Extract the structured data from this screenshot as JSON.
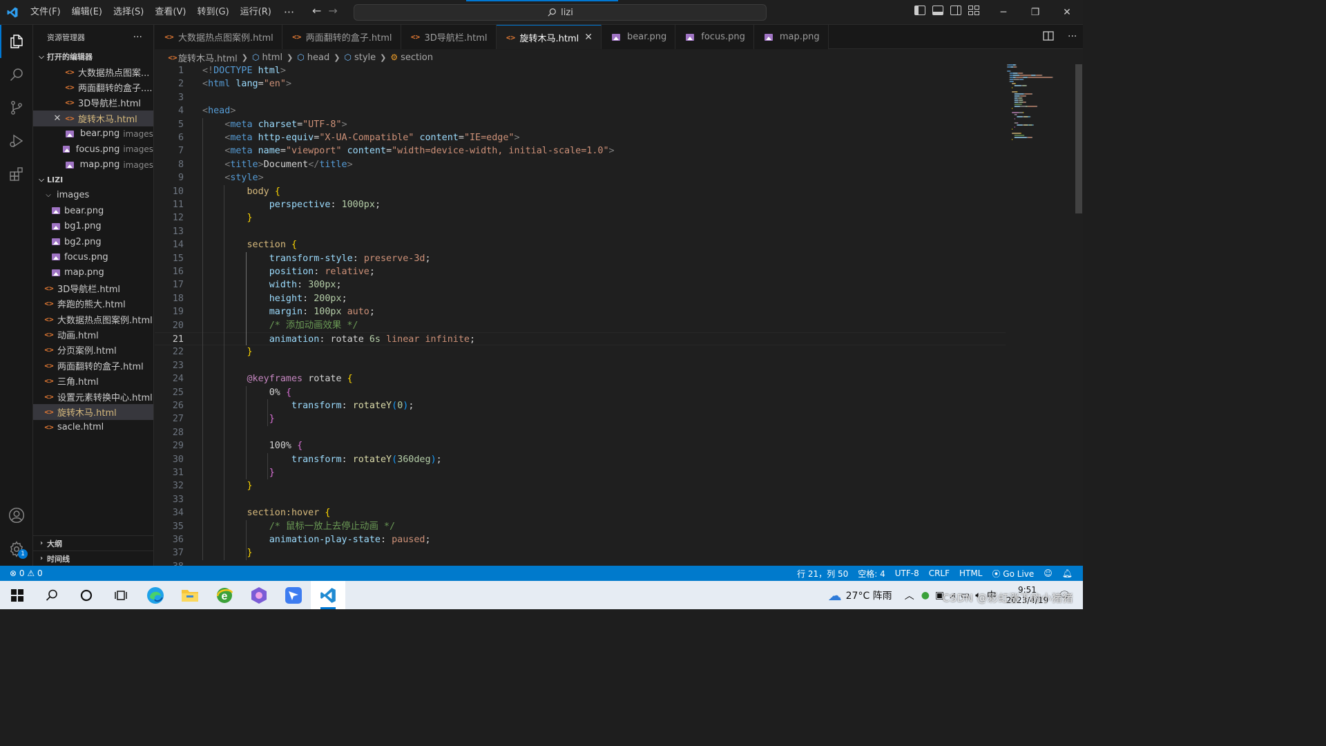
{
  "titlebar": {
    "menus": [
      "文件(F)",
      "编辑(E)",
      "选择(S)",
      "查看(V)",
      "转到(G)",
      "运行(R)"
    ],
    "more": "···",
    "search": "lizi"
  },
  "explorer": {
    "title": "资源管理器",
    "more": "···",
    "open_editors_label": "打开的编辑器",
    "open_editors": [
      {
        "name": "大数据热点图案...",
        "type": "html",
        "hint": ""
      },
      {
        "name": "两面翻转的盒子....",
        "type": "html",
        "hint": ""
      },
      {
        "name": "3D导航栏.html",
        "type": "html",
        "hint": ""
      },
      {
        "name": "旋转木马.html",
        "type": "html",
        "hint": "",
        "active": true
      },
      {
        "name": "bear.png",
        "type": "png",
        "hint": "images"
      },
      {
        "name": "focus.png",
        "type": "png",
        "hint": "images"
      },
      {
        "name": "map.png",
        "type": "png",
        "hint": "images"
      }
    ],
    "folder_label": "LIZI",
    "images_folder": "images",
    "images": [
      "bear.png",
      "bg1.png",
      "bg2.png",
      "focus.png",
      "map.png"
    ],
    "files": [
      "3D导航栏.html",
      "奔跑的熊大.html",
      "大数据热点图案例.html",
      "动画.html",
      "分页案例.html",
      "两面翻转的盒子.html",
      "三角.html",
      "设置元素转换中心.html",
      "旋转木马.html",
      "sacle.html"
    ],
    "selected_file": "旋转木马.html",
    "outline_label": "大纲",
    "timeline_label": "时间线"
  },
  "tabs": [
    {
      "label": "大数据热点图案例.html",
      "type": "html"
    },
    {
      "label": "两面翻转的盒子.html",
      "type": "html"
    },
    {
      "label": "3D导航栏.html",
      "type": "html"
    },
    {
      "label": "旋转木马.html",
      "type": "html",
      "active": true
    },
    {
      "label": "bear.png",
      "type": "png"
    },
    {
      "label": "focus.png",
      "type": "png"
    },
    {
      "label": "map.png",
      "type": "png"
    }
  ],
  "breadcrumb": [
    "旋转木马.html",
    "html",
    "head",
    "style",
    "section"
  ],
  "editor": {
    "current_line": 21,
    "lines": [
      [
        [
          "tg",
          "<!"
        ],
        [
          "tn",
          "DOCTYPE "
        ],
        [
          "at",
          "html"
        ],
        [
          "tg",
          ">"
        ]
      ],
      [
        [
          "tg",
          "<"
        ],
        [
          "tn",
          "html "
        ],
        [
          "at",
          "lang"
        ],
        [
          "tx",
          "="
        ],
        [
          "st",
          "\"en\""
        ],
        [
          "tg",
          ">"
        ]
      ],
      [],
      [
        [
          "tg",
          "<"
        ],
        [
          "tn",
          "head"
        ],
        [
          "tg",
          ">"
        ]
      ],
      [
        [
          "tx",
          "    "
        ],
        [
          "tg",
          "<"
        ],
        [
          "tn",
          "meta "
        ],
        [
          "at",
          "charset"
        ],
        [
          "tx",
          "="
        ],
        [
          "st",
          "\"UTF-8\""
        ],
        [
          "tg",
          ">"
        ]
      ],
      [
        [
          "tx",
          "    "
        ],
        [
          "tg",
          "<"
        ],
        [
          "tn",
          "meta "
        ],
        [
          "at",
          "http-equiv"
        ],
        [
          "tx",
          "="
        ],
        [
          "st",
          "\"X-UA-Compatible\" "
        ],
        [
          "at",
          "content"
        ],
        [
          "tx",
          "="
        ],
        [
          "st",
          "\"IE=edge\""
        ],
        [
          "tg",
          ">"
        ]
      ],
      [
        [
          "tx",
          "    "
        ],
        [
          "tg",
          "<"
        ],
        [
          "tn",
          "meta "
        ],
        [
          "at",
          "name"
        ],
        [
          "tx",
          "="
        ],
        [
          "st",
          "\"viewport\" "
        ],
        [
          "at",
          "content"
        ],
        [
          "tx",
          "="
        ],
        [
          "st",
          "\"width=device-width, initial-scale=1.0\""
        ],
        [
          "tg",
          ">"
        ]
      ],
      [
        [
          "tx",
          "    "
        ],
        [
          "tg",
          "<"
        ],
        [
          "tn",
          "title"
        ],
        [
          "tg",
          ">"
        ],
        [
          "tx",
          "Document"
        ],
        [
          "tg",
          "</"
        ],
        [
          "tn",
          "title"
        ],
        [
          "tg",
          ">"
        ]
      ],
      [
        [
          "tx",
          "    "
        ],
        [
          "tg",
          "<"
        ],
        [
          "tn",
          "style"
        ],
        [
          "tg",
          ">"
        ]
      ],
      [
        [
          "tx",
          "        "
        ],
        [
          "sel",
          "body "
        ],
        [
          "b1",
          "{"
        ]
      ],
      [
        [
          "tx",
          "            "
        ],
        [
          "pr",
          "perspective"
        ],
        [
          "pc",
          ": "
        ],
        [
          "nm",
          "1000px"
        ],
        [
          "pc",
          ";"
        ]
      ],
      [
        [
          "tx",
          "        "
        ],
        [
          "b1",
          "}"
        ]
      ],
      [],
      [
        [
          "tx",
          "        "
        ],
        [
          "sel",
          "section "
        ],
        [
          "b1",
          "{"
        ]
      ],
      [
        [
          "tx",
          "            "
        ],
        [
          "pr",
          "transform-style"
        ],
        [
          "pc",
          ": "
        ],
        [
          "vk",
          "preserve-3d"
        ],
        [
          "pc",
          ";"
        ]
      ],
      [
        [
          "tx",
          "            "
        ],
        [
          "pr",
          "position"
        ],
        [
          "pc",
          ": "
        ],
        [
          "vk",
          "relative"
        ],
        [
          "pc",
          ";"
        ]
      ],
      [
        [
          "tx",
          "            "
        ],
        [
          "pr",
          "width"
        ],
        [
          "pc",
          ": "
        ],
        [
          "nm",
          "300px"
        ],
        [
          "pc",
          ";"
        ]
      ],
      [
        [
          "tx",
          "            "
        ],
        [
          "pr",
          "height"
        ],
        [
          "pc",
          ": "
        ],
        [
          "nm",
          "200px"
        ],
        [
          "pc",
          ";"
        ]
      ],
      [
        [
          "tx",
          "            "
        ],
        [
          "pr",
          "margin"
        ],
        [
          "pc",
          ": "
        ],
        [
          "nm",
          "100px "
        ],
        [
          "vk",
          "auto"
        ],
        [
          "pc",
          ";"
        ]
      ],
      [
        [
          "tx",
          "            "
        ],
        [
          "cm",
          "/* 添加动画效果 */"
        ]
      ],
      [
        [
          "tx",
          "            "
        ],
        [
          "pr",
          "animation"
        ],
        [
          "pc",
          ": "
        ],
        [
          "tx",
          "rotate "
        ],
        [
          "nm",
          "6s "
        ],
        [
          "vk",
          "linear infinite"
        ],
        [
          "pc",
          ";"
        ]
      ],
      [
        [
          "tx",
          "        "
        ],
        [
          "b1",
          "}"
        ]
      ],
      [],
      [
        [
          "tx",
          "        "
        ],
        [
          "kw",
          "@keyframes "
        ],
        [
          "tx",
          "rotate "
        ],
        [
          "b1",
          "{"
        ]
      ],
      [
        [
          "tx",
          "            "
        ],
        [
          "tx",
          "0% "
        ],
        [
          "b2",
          "{"
        ]
      ],
      [
        [
          "tx",
          "                "
        ],
        [
          "pr",
          "transform"
        ],
        [
          "pc",
          ": "
        ],
        [
          "fn",
          "rotateY"
        ],
        [
          "b3",
          "("
        ],
        [
          "nm",
          "0"
        ],
        [
          "b3",
          ")"
        ],
        [
          "pc",
          ";"
        ]
      ],
      [
        [
          "tx",
          "            "
        ],
        [
          "b2",
          "}"
        ]
      ],
      [],
      [
        [
          "tx",
          "            "
        ],
        [
          "tx",
          "100% "
        ],
        [
          "b2",
          "{"
        ]
      ],
      [
        [
          "tx",
          "                "
        ],
        [
          "pr",
          "transform"
        ],
        [
          "pc",
          ": "
        ],
        [
          "fn",
          "rotateY"
        ],
        [
          "b3",
          "("
        ],
        [
          "nm",
          "360deg"
        ],
        [
          "b3",
          ")"
        ],
        [
          "pc",
          ";"
        ]
      ],
      [
        [
          "tx",
          "            "
        ],
        [
          "b2",
          "}"
        ]
      ],
      [
        [
          "tx",
          "        "
        ],
        [
          "b1",
          "}"
        ]
      ],
      [],
      [
        [
          "tx",
          "        "
        ],
        [
          "sel",
          "section:hover "
        ],
        [
          "b1",
          "{"
        ]
      ],
      [
        [
          "tx",
          "            "
        ],
        [
          "cm",
          "/* 鼠标一放上去停止动画 */"
        ]
      ],
      [
        [
          "tx",
          "            "
        ],
        [
          "pr",
          "animation-play-state"
        ],
        [
          "pc",
          ": "
        ],
        [
          "vk",
          "paused"
        ],
        [
          "pc",
          ";"
        ]
      ],
      [
        [
          "tx",
          "        "
        ],
        [
          "b1",
          "}"
        ]
      ],
      []
    ]
  },
  "statusbar": {
    "errors": "0",
    "warnings": "0",
    "position": "行 21，列 50",
    "spaces": "空格: 4",
    "encoding": "UTF-8",
    "eol": "CRLF",
    "language": "HTML",
    "golive": "Go Live"
  },
  "taskbar": {
    "weather": "27°C 阵雨",
    "time": "9:51",
    "date": "2023/4/19",
    "watermark": "CSDN @彩虹涨下的小猪猪",
    "ime": "中"
  },
  "colors": {
    "accent": "#0078d4",
    "status": "#007acc",
    "editor_bg": "#1f1f1f"
  }
}
